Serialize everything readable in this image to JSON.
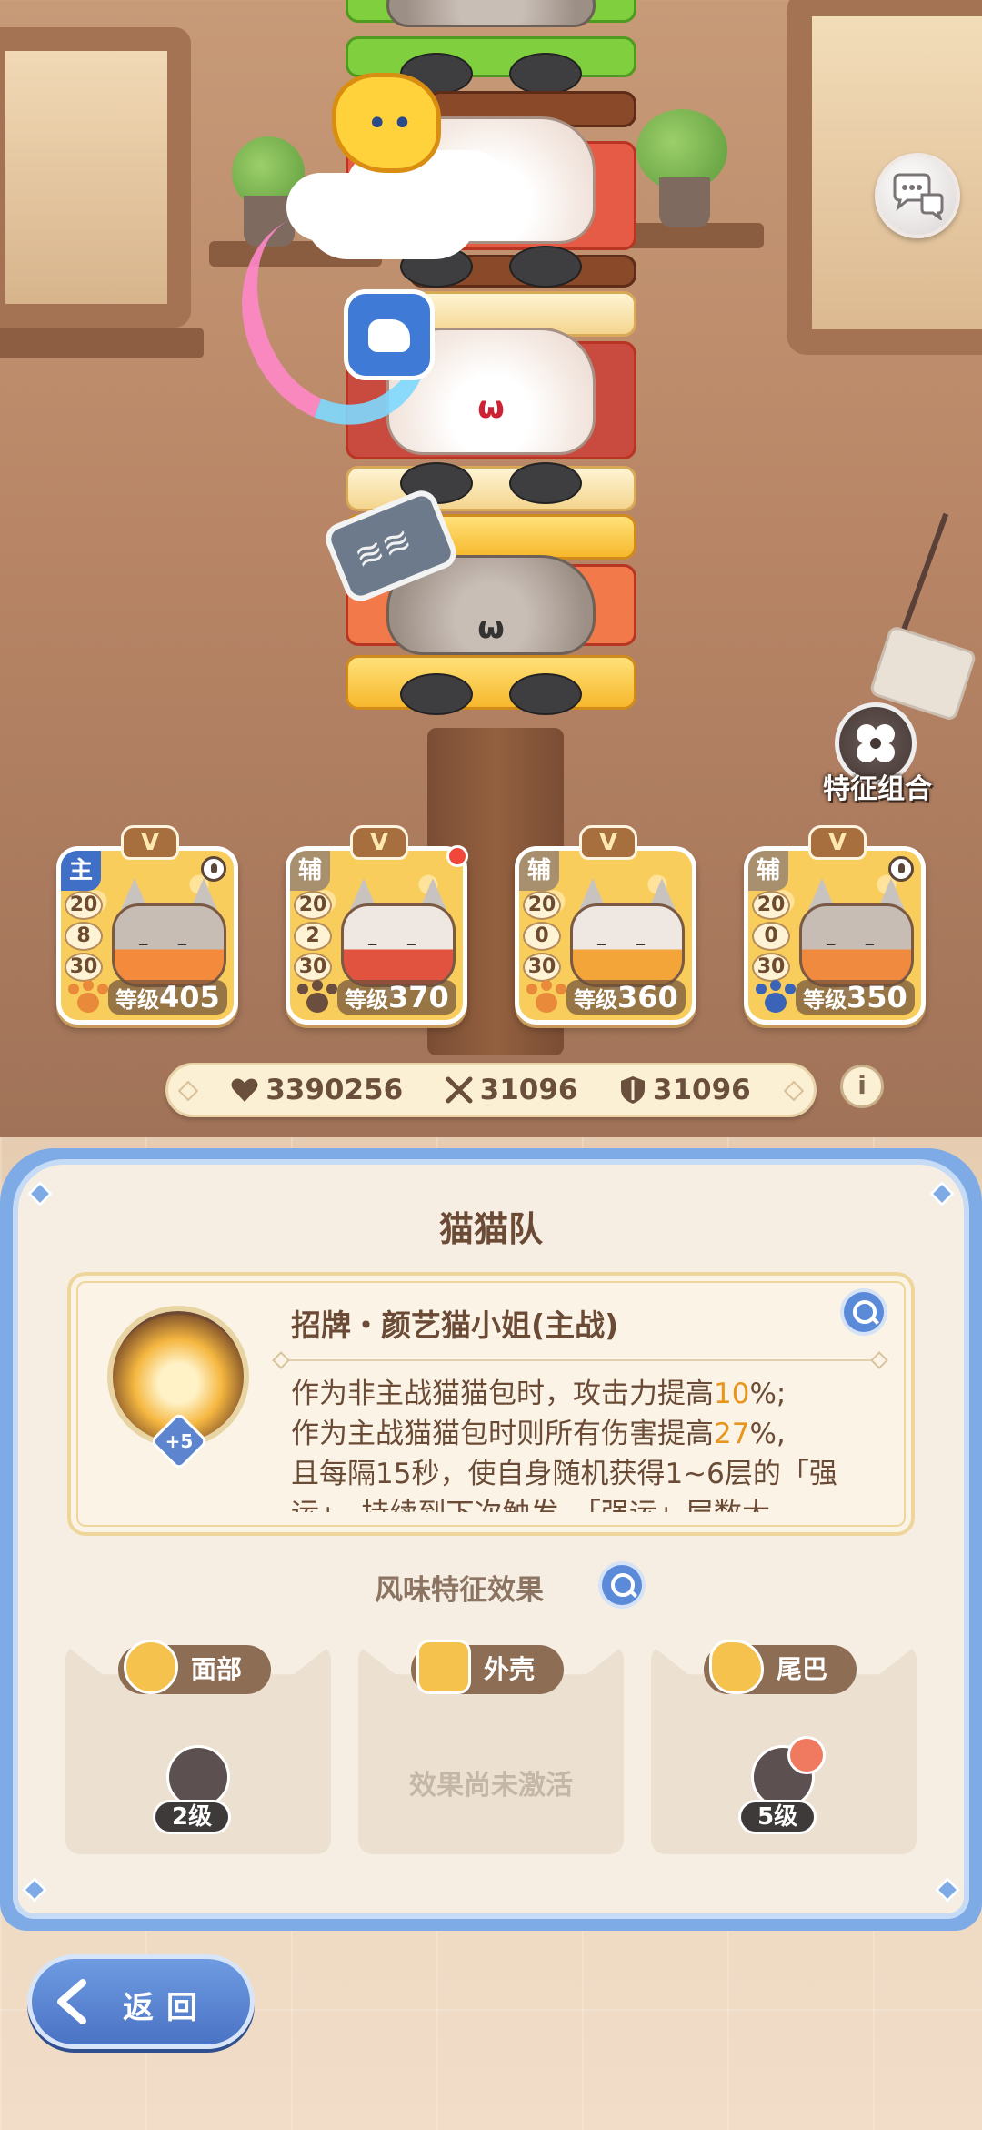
{
  "colors": {
    "panel_border": "#7eaae6",
    "highlight": "#e8951d",
    "main_role": "#3f6fc6",
    "sub_role": "#a8906e"
  },
  "top": {
    "chat_icon": "chat-bubbles-icon"
  },
  "trait_combo": {
    "label": "特征组合",
    "icon": "clover-icon"
  },
  "team": [
    {
      "role": "主",
      "tier": "V",
      "stats": [
        "20",
        "8",
        "30"
      ],
      "level_prefix": "等级",
      "level": "405",
      "lock": true,
      "notify": false,
      "paw_color": "#e88a3a",
      "body_color": "#f48a3c",
      "fur": "#c8bdb5"
    },
    {
      "role": "辅",
      "tier": "V",
      "stats": [
        "20",
        "2",
        "30"
      ],
      "level_prefix": "等级",
      "level": "370",
      "lock": false,
      "notify": true,
      "paw_color": "#6b4e3e",
      "body_color": "#e2533f",
      "fur": "#efe7e2"
    },
    {
      "role": "辅",
      "tier": "V",
      "stats": [
        "20",
        "0",
        "30"
      ],
      "level_prefix": "等级",
      "level": "360",
      "lock": false,
      "notify": false,
      "paw_color": "#e88a3a",
      "body_color": "#f3a53a",
      "fur": "#efe7e2"
    },
    {
      "role": "辅",
      "tier": "V",
      "stats": [
        "20",
        "0",
        "30"
      ],
      "level_prefix": "等级",
      "level": "350",
      "lock": true,
      "notify": false,
      "paw_color": "#3b63b8",
      "body_color": "#f08a3e",
      "fur": "#c8bdb5"
    }
  ],
  "stats": {
    "hp": "3390256",
    "attack": "31096",
    "defense": "31096",
    "info": "i"
  },
  "panel": {
    "title": "猫猫队",
    "skill": {
      "name": "招牌・颜艺猫小姐(主战)",
      "plus": "+5",
      "line1_pre": "作为非主战猫猫包时，攻击力提高",
      "line1_val": "10",
      "line1_post": "%;",
      "line2_pre": "作为主战猫猫包时则所有伤害提高",
      "line2_val": "27",
      "line2_post": "%,",
      "line3": "且每隔15秒，使自身随机获得1~6层的「强",
      "line4": "运」，持续到下次触发，「强运」层数大"
    },
    "flavor_title": "风味特征效果",
    "slots": [
      {
        "tag": "面部",
        "level": "2级",
        "inactive_text": ""
      },
      {
        "tag": "外壳",
        "level": "",
        "inactive_text": "效果尚未激活"
      },
      {
        "tag": "尾巴",
        "level": "5级",
        "inactive_text": ""
      }
    ]
  },
  "back": {
    "label": "返回"
  }
}
